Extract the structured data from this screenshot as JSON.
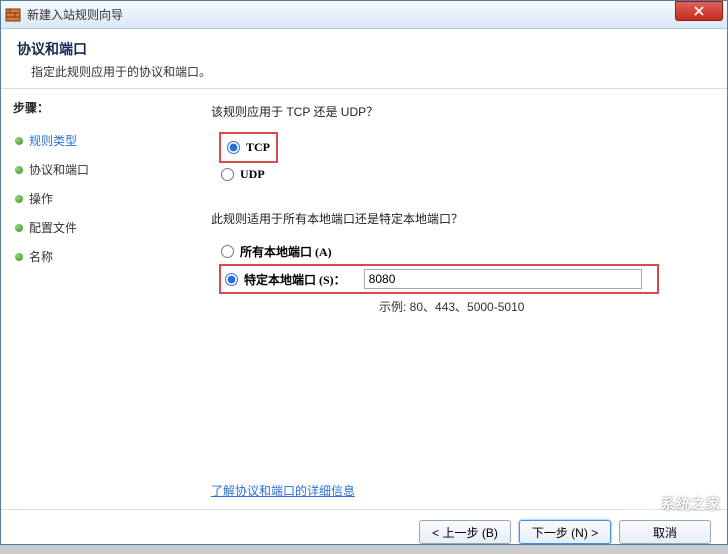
{
  "titlebar": {
    "text": "新建入站规则向导"
  },
  "header": {
    "title": "协议和端口",
    "subtitle": "指定此规则应用于的协议和端口。"
  },
  "sidebar": {
    "title": "步骤：",
    "items": [
      {
        "label": "规则类型",
        "active": true
      },
      {
        "label": "协议和端口",
        "active": false
      },
      {
        "label": "操作",
        "active": false
      },
      {
        "label": "配置文件",
        "active": false
      },
      {
        "label": "名称",
        "active": false
      }
    ]
  },
  "content": {
    "question1": "该规则应用于 TCP 还是 UDP？",
    "tcp_label": "TCP",
    "udp_label": "UDP",
    "question2": "此规则适用于所有本地端口还是特定本地端口？",
    "all_ports_label": "所有本地端口 (A)",
    "specific_ports_label": "特定本地端口 (S)：",
    "port_value": "8080",
    "example_label": "示例: 80、443、5000-5010",
    "link_text": "了解协议和端口的详细信息"
  },
  "footer": {
    "back": "< 上一步 (B)",
    "next": "下一步 (N) >",
    "cancel": "取消"
  },
  "watermark": {
    "text": "系统之家"
  }
}
